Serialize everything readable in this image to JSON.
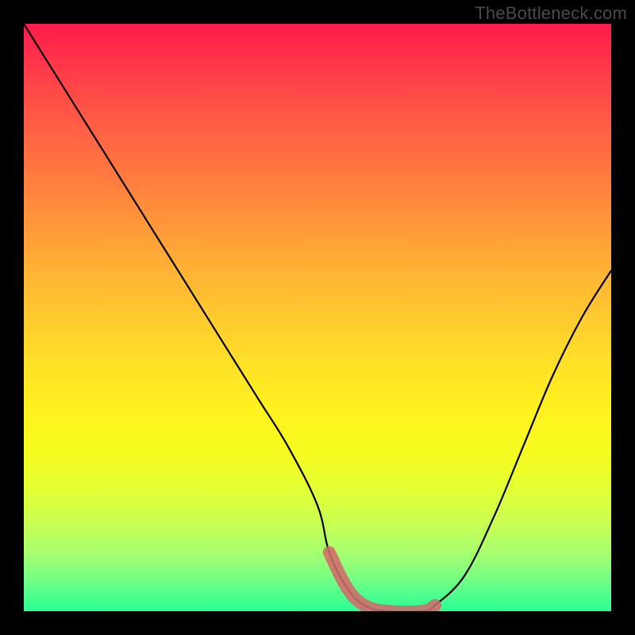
{
  "watermark": "TheBottleneck.com",
  "colors": {
    "background": "#000000",
    "watermark_text": "#4a4a4a",
    "curve": "#000000",
    "marker": "#d26b6b"
  },
  "chart_data": {
    "type": "line",
    "title": "",
    "xlabel": "",
    "ylabel": "",
    "xlim": [
      0,
      100
    ],
    "ylim": [
      0,
      100
    ],
    "grid": false,
    "series": [
      {
        "name": "bottleneck-curve",
        "x": [
          0,
          5,
          10,
          15,
          20,
          25,
          30,
          35,
          40,
          45,
          50,
          52,
          55,
          58,
          62,
          68,
          70,
          75,
          80,
          85,
          90,
          95,
          100
        ],
        "y": [
          100,
          92,
          84,
          76,
          68,
          60,
          52,
          44,
          36,
          28,
          18,
          10,
          4,
          1,
          0,
          0,
          1,
          6,
          16,
          28,
          40,
          50,
          58
        ]
      }
    ],
    "highlight_segment": {
      "name": "minimum-region",
      "x": [
        52,
        55,
        58,
        62,
        68,
        70
      ],
      "y": [
        10,
        4,
        1,
        0,
        0,
        1
      ]
    },
    "background_fill": {
      "type": "vertical-gradient",
      "top_color": "#ff1a4b",
      "bottom_color": "#28ff95",
      "stops": [
        "red",
        "orange",
        "yellow",
        "green"
      ]
    }
  }
}
